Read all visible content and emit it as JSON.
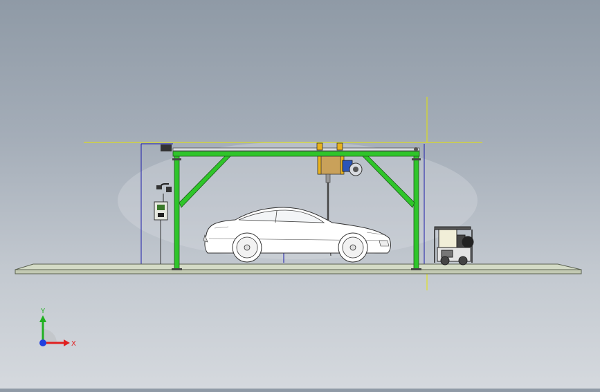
{
  "viewport": {
    "background_top": "#8f9aa6",
    "background_bottom": "#d5d9de"
  },
  "model": {
    "components": [
      "floor-slab",
      "gantry-frame",
      "overhead-carriage",
      "wash-arm",
      "car",
      "control-panel",
      "pressure-washer"
    ],
    "frame_color": "#2fc52a",
    "carriage_color": "#e8b21f",
    "motor_color": "#2b55b8",
    "floor_color": "#c8d0b8",
    "sketch_line_color": "#e8e800",
    "dimension_line_color": "#1a1aa8"
  },
  "triad": {
    "x_label": "X",
    "y_label": "Y",
    "x_color": "#e02020",
    "y_color": "#20b020",
    "z_color": "#2040e0"
  }
}
